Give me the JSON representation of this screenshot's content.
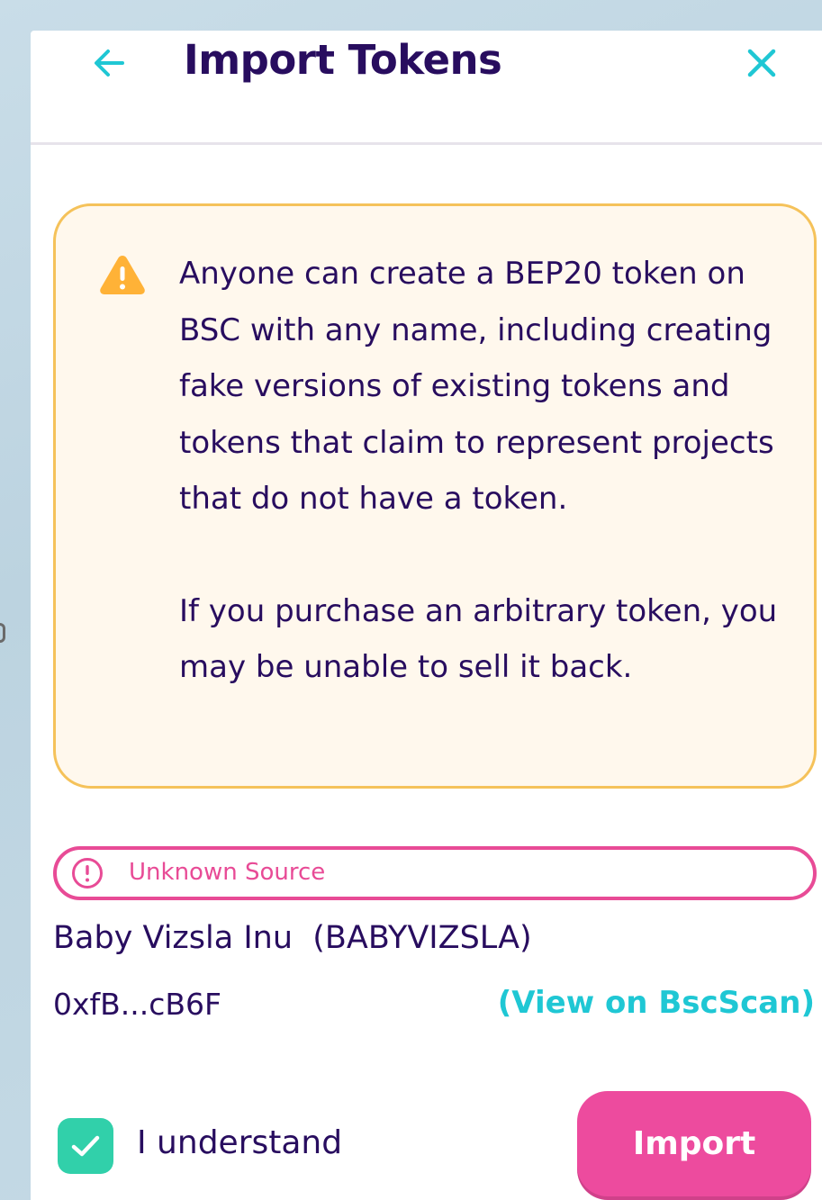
{
  "modal": {
    "title": "Import Tokens"
  },
  "warning": {
    "paragraph1": "Anyone can create a BEP20 token on BSC with any name, including creating fake versions of existing tokens and tokens that claim to represent projects that do not have a token.",
    "paragraph2": "If you purchase an arbitrary token, you may be unable to sell it back."
  },
  "source": {
    "label": "Unknown Source"
  },
  "token": {
    "name": "Baby Vizsla Inu  (BABYVIZSLA)",
    "address": "0xfB...cB6F",
    "scan_link": "(View on BscScan)"
  },
  "acknowledge": {
    "label": "I understand",
    "checked": true
  },
  "actions": {
    "import_label": "Import"
  },
  "icons": {
    "back": "arrow-left-icon",
    "close": "close-icon",
    "warning": "warning-triangle-icon",
    "source": "exclamation-circle-icon",
    "check": "checkmark-icon"
  },
  "colors": {
    "primary_text": "#280d5f",
    "accent": "#1fc7d4",
    "pink": "#ed4b9e",
    "success": "#31d0aa",
    "warning": "#ffb237",
    "warning_bg": "#fff8ed"
  }
}
